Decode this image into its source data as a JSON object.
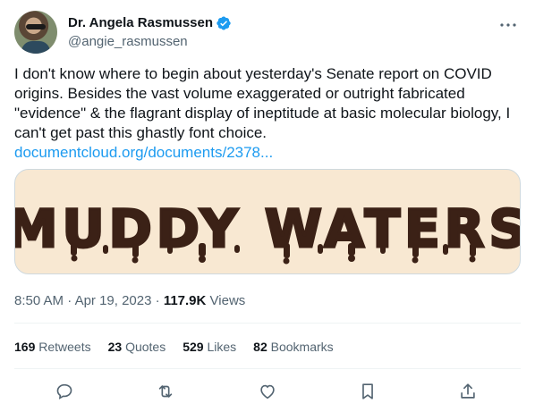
{
  "author": {
    "display_name": "Dr. Angela Rasmussen",
    "handle": "@angie_rasmussen",
    "verified": true,
    "verified_color": "#1d9bf0"
  },
  "tweet": {
    "text": "I don't know where to begin about yesterday's Senate report on COVID origins. Besides the vast volume exaggerated or outright fabricated \"evidence\" & the flagrant display of ineptitude at basic molecular biology, I can't get past this ghastly font choice.",
    "link_text": "documentcloud.org/documents/2378...",
    "media_text": "MUDDY WATERS",
    "time": "8:50 AM",
    "date": "Apr 19, 2023",
    "views_count": "117.9K",
    "views_label": "Views"
  },
  "stats": [
    {
      "count": "169",
      "label": "Retweets"
    },
    {
      "count": "23",
      "label": "Quotes"
    },
    {
      "count": "529",
      "label": "Likes"
    },
    {
      "count": "82",
      "label": "Bookmarks"
    }
  ],
  "icons": {
    "reply": "reply-icon",
    "retweet": "retweet-icon",
    "like": "like-icon",
    "bookmark": "bookmark-icon",
    "share": "share-icon",
    "more": "more-icon"
  },
  "colors": {
    "text": "#0f1419",
    "secondary": "#536471",
    "link": "#1d9bf0",
    "media_bg": "#f8e8d2",
    "media_text": "#3b2116"
  }
}
